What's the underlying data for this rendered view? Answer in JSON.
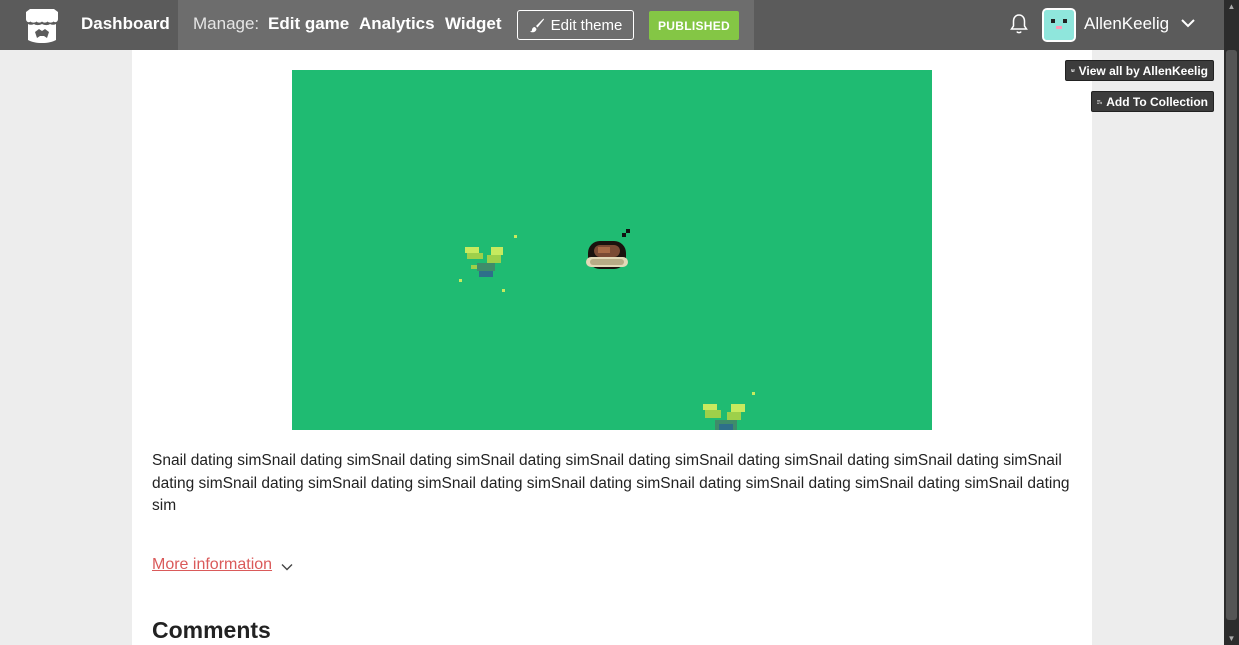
{
  "topbar": {
    "dashboard_label": "Dashboard",
    "manage_label": "Manage:",
    "links": [
      "Edit game",
      "Analytics",
      "Widget"
    ],
    "edit_theme_label": "Edit theme",
    "published_label": "PUBLISHED",
    "username": "AllenKeelig"
  },
  "side_buttons": {
    "view_all": "View all by AllenKeelig",
    "add_collection": "Add To Collection"
  },
  "content": {
    "description": "Snail dating simSnail dating simSnail dating simSnail dating simSnail dating simSnail dating simSnail dating simSnail dating simSnail dating simSnail dating simSnail dating simSnail dating simSnail dating simSnail dating simSnail dating simSnail dating simSnail dating sim",
    "more_info": "More information",
    "comments_title": "Comments"
  },
  "colors": {
    "topbar": "#5b5b5b",
    "manage_panel": "#6d6d6d",
    "published": "#84c645",
    "game_bg": "#1fbb72",
    "link_red": "#da5a5a"
  },
  "icons": [
    "itchio-logo-icon",
    "paintbrush-icon",
    "bell-icon",
    "chevron-down-icon",
    "itchio-store-icon",
    "add-list-icon"
  ]
}
